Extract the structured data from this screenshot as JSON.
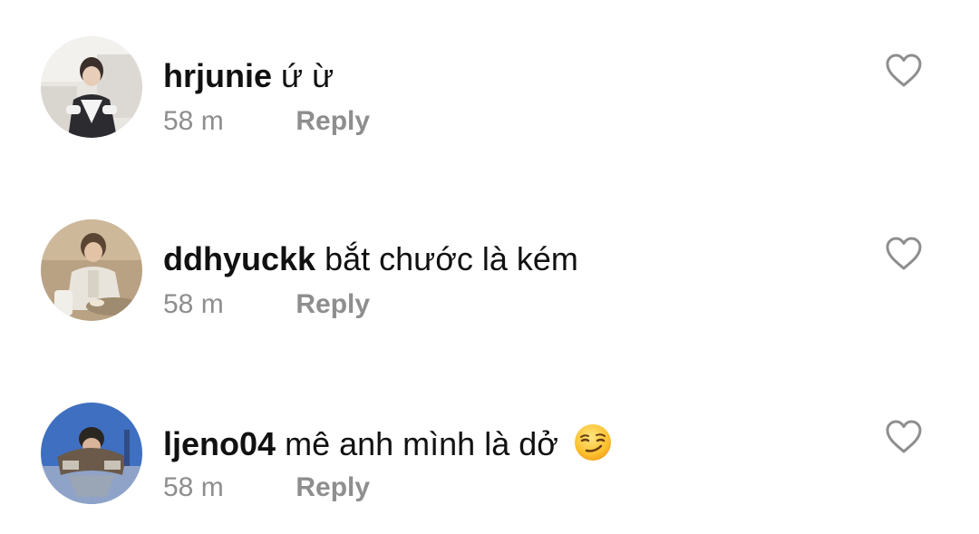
{
  "comments": [
    {
      "username": "hrjunie",
      "text": "ứ ừ",
      "time": "58 m",
      "reply_label": "Reply",
      "emoji": null
    },
    {
      "username": "ddhyuckk",
      "text": "bắt chước là kém",
      "time": "58 m",
      "reply_label": "Reply",
      "emoji": null
    },
    {
      "username": "ljeno04",
      "text": "mê anh mình là dở",
      "time": "58 m",
      "reply_label": "Reply",
      "emoji": "smirking-face-emoji"
    }
  ],
  "colors": {
    "meta_gray": "#8e8e8e",
    "text": "#111111",
    "heart_outline": "#8e8e8e"
  },
  "icons": {
    "like": "heart-outline-icon"
  }
}
